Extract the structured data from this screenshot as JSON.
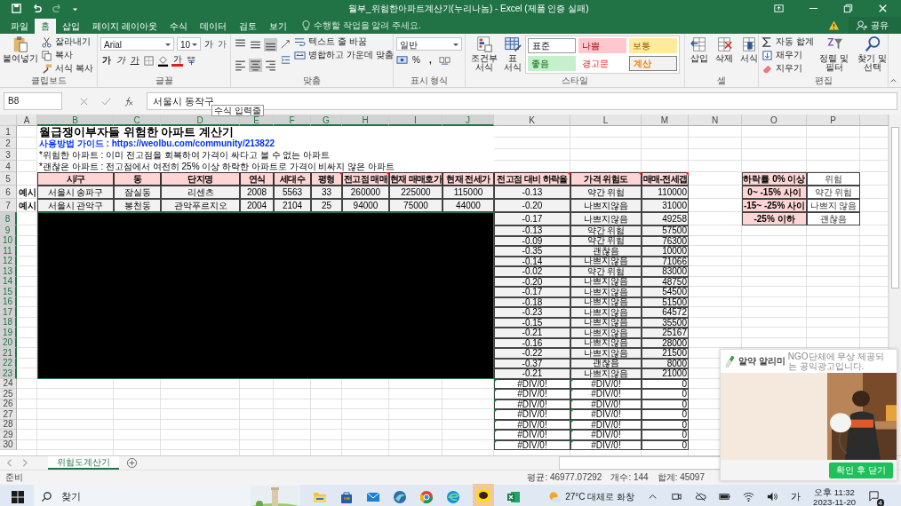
{
  "window": {
    "title": "월부_위험한아파트계산기(누리나놈) - Excel (제품 인증 실패)"
  },
  "ribbon_tabs": [
    {
      "label": "파일",
      "selected": false
    },
    {
      "label": "홈",
      "selected": true
    },
    {
      "label": "삽입",
      "selected": false
    },
    {
      "label": "페이지 레이아웃",
      "selected": false
    },
    {
      "label": "수식",
      "selected": false
    },
    {
      "label": "데이터",
      "selected": false
    },
    {
      "label": "검토",
      "selected": false
    },
    {
      "label": "보기",
      "selected": false
    }
  ],
  "tell_me": {
    "placeholder": "수행할 작업을 알려 주세요."
  },
  "share_button": "공유",
  "ribbon": {
    "clipboard": {
      "label": "클립보드",
      "paste": "붙여넣기",
      "items": [
        {
          "kind": "cut",
          "label": "잘라내기"
        },
        {
          "kind": "copy",
          "label": "복사"
        },
        {
          "kind": "painter",
          "label": "서식 복사"
        }
      ]
    },
    "font": {
      "label": "글꼴",
      "font_name": "Arial",
      "font_size": "10",
      "grow": "가",
      "shrink": "가",
      "bold": "가",
      "italic": "가",
      "underline": "가",
      "font_color": "가"
    },
    "alignment": {
      "label": "맞춤",
      "align_buttons": [
        {
          "kind": "top",
          "selected": false
        },
        {
          "kind": "middle",
          "selected": false
        },
        {
          "kind": "bottom",
          "selected": true
        },
        {
          "kind": "left",
          "selected": false
        },
        {
          "kind": "center",
          "selected": true
        },
        {
          "kind": "right",
          "selected": false
        }
      ],
      "wrap_text": "텍스트 줄 바꿈",
      "merge_center": "병합하고 가운데 맞춤"
    },
    "number": {
      "label": "표시 형식",
      "format": "일반",
      "percent": "%",
      "comma": ","
    },
    "styles": {
      "label": "스타일",
      "conditional": "조건부 서식",
      "table_format": "표 서식",
      "gallery": [
        {
          "label": "표준",
          "kind": "normal"
        },
        {
          "label": "나쁨",
          "kind": "bad"
        },
        {
          "label": "보통",
          "kind": "neutral"
        },
        {
          "label": "좋음",
          "kind": "good"
        },
        {
          "label": "경고문",
          "kind": "warning"
        },
        {
          "label": "계산",
          "kind": "calculation"
        }
      ]
    },
    "cells": {
      "label": "셀",
      "buttons": [
        {
          "kind": "insert",
          "label": "삽입"
        },
        {
          "kind": "delete",
          "label": "삭제"
        },
        {
          "kind": "format",
          "label": "서식"
        }
      ]
    },
    "editing": {
      "label": "편집",
      "autosum": "자동 합계",
      "fill": "채우기",
      "clear": "지우기",
      "sort": "정렬 및 필터",
      "find": "찾기 및 선택"
    }
  },
  "formula_bar": {
    "name_box": "B8",
    "formula": "서울시 동작구",
    "tooltip": "수식 입력줄"
  },
  "sheet": {
    "columns": [
      {
        "label": "A",
        "selected": false
      },
      {
        "label": "B",
        "selected": true
      },
      {
        "label": "C",
        "selected": true
      },
      {
        "label": "D",
        "selected": true
      },
      {
        "label": "E",
        "selected": true
      },
      {
        "label": "F",
        "selected": true
      },
      {
        "label": "G",
        "selected": true
      },
      {
        "label": "H",
        "selected": true
      },
      {
        "label": "I",
        "selected": true
      },
      {
        "label": "J",
        "selected": true
      },
      {
        "label": "K",
        "selected": false
      },
      {
        "label": "L",
        "selected": false
      },
      {
        "label": "M",
        "selected": false
      },
      {
        "label": "N",
        "selected": false
      },
      {
        "label": "O",
        "selected": false
      },
      {
        "label": "P",
        "selected": false
      }
    ],
    "rows": [
      {
        "label": "1",
        "selected": false
      },
      {
        "label": "2",
        "selected": false
      },
      {
        "label": "3",
        "selected": false
      },
      {
        "label": "4",
        "selected": false
      },
      {
        "label": "5",
        "selected": false
      },
      {
        "label": "6",
        "selected": false
      },
      {
        "label": "7",
        "selected": false
      },
      {
        "label": "8",
        "selected": true
      },
      {
        "label": "9",
        "selected": true
      },
      {
        "label": "10",
        "selected": true
      },
      {
        "label": "11",
        "selected": true
      },
      {
        "label": "12",
        "selected": true
      },
      {
        "label": "13",
        "selected": true
      },
      {
        "label": "14",
        "selected": true
      },
      {
        "label": "15",
        "selected": true
      },
      {
        "label": "16",
        "selected": true
      },
      {
        "label": "17",
        "selected": true
      },
      {
        "label": "18",
        "selected": true
      },
      {
        "label": "19",
        "selected": true
      },
      {
        "label": "20",
        "selected": true
      },
      {
        "label": "21",
        "selected": true
      },
      {
        "label": "22",
        "selected": true
      },
      {
        "label": "23",
        "selected": true
      },
      {
        "label": "24",
        "selected": false
      },
      {
        "label": "25",
        "selected": false
      },
      {
        "label": "26",
        "selected": false
      },
      {
        "label": "27",
        "selected": false
      },
      {
        "label": "28",
        "selected": false
      },
      {
        "label": "29",
        "selected": false
      },
      {
        "label": "30",
        "selected": false
      }
    ],
    "title": "월급쟁이부자들 위험한 아파트 계산기",
    "guide": "사용방법 가이드 : https://weolbu.com/community/213822",
    "notes": [
      "*위험한 아파트 : 이미 전고점을 회복하여 가격이 싸다고 볼 수 없는 아파트",
      "*괜찮은 아파트 : 전고점에서 여전히 25% 이상 하락한 아파트로 가격이 비싸지 않은 아파트"
    ],
    "table": {
      "header": [
        {
          "label": "시/구",
          "comment": false
        },
        {
          "label": "동",
          "comment": false
        },
        {
          "label": "단지명",
          "comment": false
        },
        {
          "label": "연식",
          "comment": false
        },
        {
          "label": "세대수",
          "comment": false
        },
        {
          "label": "평형",
          "comment": true
        },
        {
          "label": "전고점 매매",
          "comment": true
        },
        {
          "label": "현재 매매호가",
          "comment": false
        },
        {
          "label": "현재 전세가",
          "comment": false
        },
        {
          "label": "전고점 대비 하락율",
          "comment": true
        },
        {
          "label": "가격 위험도",
          "comment": true
        },
        {
          "label": "매매-전세갭",
          "comment": true
        }
      ],
      "examples": [
        {
          "label": "예시",
          "cells": [
            "서울시 송파구",
            "잠실동",
            "리센츠",
            "2008",
            "5563",
            "33",
            "260000",
            "225000",
            "115000",
            "-0.13",
            "약간 위험",
            "110000"
          ]
        },
        {
          "label": "예시",
          "cells": [
            "서울시 관악구",
            "봉천동",
            "관악푸르지오",
            "2004",
            "2104",
            "25",
            "94000",
            "75000",
            "44000",
            "-0.20",
            "나쁘지않음",
            "31000"
          ]
        }
      ],
      "results": [
        {
          "kind": "redacted",
          "cells": [
            "-0.17",
            "나쁘지않음",
            "49258"
          ]
        },
        {
          "kind": "redacted",
          "cells": [
            "-0.13",
            "약간 위험",
            "57500"
          ]
        },
        {
          "kind": "redacted",
          "cells": [
            "-0.09",
            "약간 위험",
            "76300"
          ]
        },
        {
          "kind": "redacted",
          "cells": [
            "-0.35",
            "괜찮음",
            "10000"
          ]
        },
        {
          "kind": "redacted",
          "cells": [
            "-0.14",
            "나쁘지않음",
            "71066"
          ]
        },
        {
          "kind": "redacted",
          "cells": [
            "-0.02",
            "약간 위험",
            "83000"
          ]
        },
        {
          "kind": "redacted",
          "cells": [
            "-0.20",
            "나쁘지않음",
            "48750"
          ]
        },
        {
          "kind": "redacted",
          "cells": [
            "-0.17",
            "나쁘지않음",
            "54500"
          ]
        },
        {
          "kind": "redacted",
          "cells": [
            "-0.18",
            "나쁘지않음",
            "51500"
          ]
        },
        {
          "kind": "redacted",
          "cells": [
            "-0.23",
            "나쁘지않음",
            "64572"
          ]
        },
        {
          "kind": "redacted",
          "cells": [
            "-0.15",
            "나쁘지않음",
            "35500"
          ]
        },
        {
          "kind": "redacted",
          "cells": [
            "-0.21",
            "나쁘지않음",
            "25167"
          ]
        },
        {
          "kind": "redacted",
          "cells": [
            "-0.16",
            "나쁘지않음",
            "28000"
          ]
        },
        {
          "kind": "redacted",
          "cells": [
            "-0.22",
            "나쁘지않음",
            "21500"
          ]
        },
        {
          "kind": "redacted",
          "cells": [
            "-0.37",
            "괜찮음",
            "8000"
          ]
        },
        {
          "kind": "redacted",
          "cells": [
            "-0.21",
            "나쁘지않음",
            "21000"
          ]
        },
        {
          "kind": "error",
          "cells": [
            "#DIV/0!",
            "#DIV/0!",
            "0"
          ]
        },
        {
          "kind": "error",
          "cells": [
            "#DIV/0!",
            "#DIV/0!",
            "0"
          ]
        },
        {
          "kind": "error",
          "cells": [
            "#DIV/0!",
            "#DIV/0!",
            "0"
          ]
        },
        {
          "kind": "error",
          "cells": [
            "#DIV/0!",
            "#DIV/0!",
            "0"
          ]
        },
        {
          "kind": "error",
          "cells": [
            "#DIV/0!",
            "#DIV/0!",
            "0"
          ]
        },
        {
          "kind": "error",
          "cells": [
            "#DIV/0!",
            "#DIV/0!",
            "0"
          ]
        },
        {
          "kind": "error",
          "cells": [
            "#DIV/0!",
            "#DIV/0!",
            "0"
          ]
        }
      ]
    },
    "legend": [
      {
        "range": "하락률 0% 이상",
        "rating": "위험"
      },
      {
        "range": "0~ -15% 사이",
        "rating": "약간 위험"
      },
      {
        "range": "-15~ -25% 사이",
        "rating": "나쁘지 않음"
      },
      {
        "range": "-25% 이하",
        "rating": "괜찮음"
      }
    ]
  },
  "sheet_tabs": [
    {
      "label": "위험도계산기",
      "selected": true
    }
  ],
  "status_bar": {
    "mode": "준비",
    "average": "평균: 46977.07292",
    "count": "개수: 144",
    "sum": "합계: 45097"
  },
  "popup": {
    "app": "알약 알리미",
    "notice": "NGO단체에 무상 제공되는 공익광고입니다.",
    "button": "확인 후 닫기"
  },
  "taskbar": {
    "search": "찾기",
    "weather": "27°C 대체로 화창",
    "ime": "가",
    "time": "오후 11:32",
    "date": "2023-11-20",
    "badge": "4"
  }
}
